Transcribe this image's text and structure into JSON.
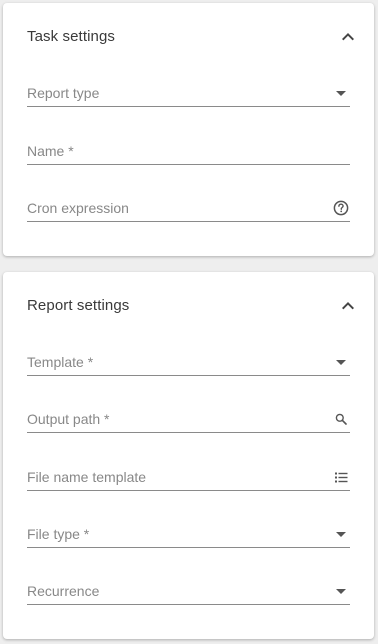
{
  "task_settings": {
    "title": "Task settings",
    "fields": {
      "report_type": {
        "label": "Report type",
        "icon": "dropdown-arrow-icon"
      },
      "name": {
        "label": "Name *"
      },
      "cron_expression": {
        "label": "Cron expression",
        "icon": "help-circle-icon"
      }
    }
  },
  "report_settings": {
    "title": "Report settings",
    "fields": {
      "template": {
        "label": "Template *",
        "icon": "dropdown-arrow-icon"
      },
      "output_path": {
        "label": "Output path *",
        "icon": "search-icon"
      },
      "file_name_template": {
        "label": "File name template",
        "icon": "list-icon"
      },
      "file_type": {
        "label": "File type *",
        "icon": "dropdown-arrow-icon"
      },
      "recurrence": {
        "label": "Recurrence",
        "icon": "dropdown-arrow-icon"
      }
    }
  },
  "colors": {
    "background": "#eeeeee",
    "card": "#ffffff",
    "label": "#888888",
    "title": "#3a3a3a",
    "icon": "#555555"
  }
}
